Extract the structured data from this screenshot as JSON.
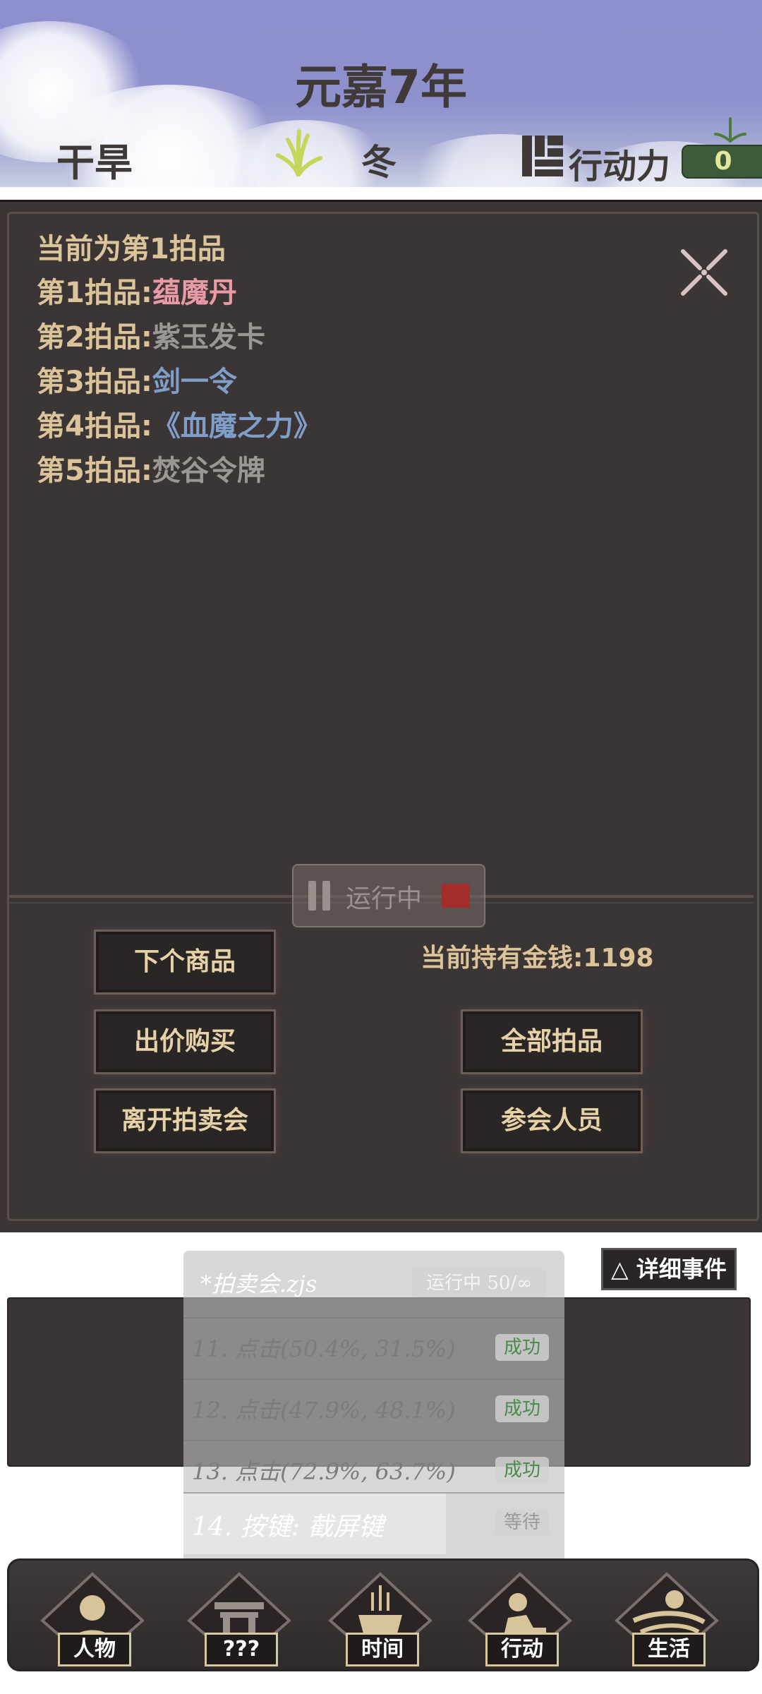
{
  "header": {
    "title": "元嘉7年",
    "weather": "干旱",
    "season": "冬",
    "action_label": "行动力",
    "action_value": "0"
  },
  "auction": {
    "current": "当前为第1拍品",
    "items": [
      {
        "prefix": "第1拍品:",
        "name": "蕴魔丹",
        "color": "#e89aa6"
      },
      {
        "prefix": "第2拍品:",
        "name": "紫玉发卡",
        "color": "#9c9794"
      },
      {
        "prefix": "第3拍品:",
        "name": "剑一令",
        "color": "#7f9ec9"
      },
      {
        "prefix": "第4拍品:",
        "name": "《血魔之力》",
        "color": "#7f9ec9"
      },
      {
        "prefix": "第5拍品:",
        "name": "焚谷令牌",
        "color": "#9c9794"
      }
    ],
    "money": "当前持有金钱:1198",
    "buttons": {
      "next": "下个商品",
      "bid": "出价购买",
      "leave": "离开拍卖会",
      "all": "全部拍品",
      "members": "参会人员"
    }
  },
  "runner": {
    "text": "运行中"
  },
  "events": {
    "detail_button": "△ 详细事件"
  },
  "script": {
    "name": "*拍卖会.zjs",
    "status": "运行中 50/∞",
    "steps": [
      {
        "text": "11. 点击(50.4%, 31.5%)",
        "state": "成功"
      },
      {
        "text": "12. 点击(47.9%, 48.1%)",
        "state": "成功"
      },
      {
        "text": "13. 点击(72.9%, 63.7%)",
        "state": "成功"
      },
      {
        "text": "14. 按键: 截屏键",
        "state": "等待"
      }
    ]
  },
  "nav": {
    "items": [
      "人物",
      "???",
      "时间",
      "行动",
      "生活"
    ]
  },
  "colors": {
    "panel_bg": "#3c3535",
    "text_gold": "#dcc49a",
    "success_green": "#4a8a4a"
  }
}
